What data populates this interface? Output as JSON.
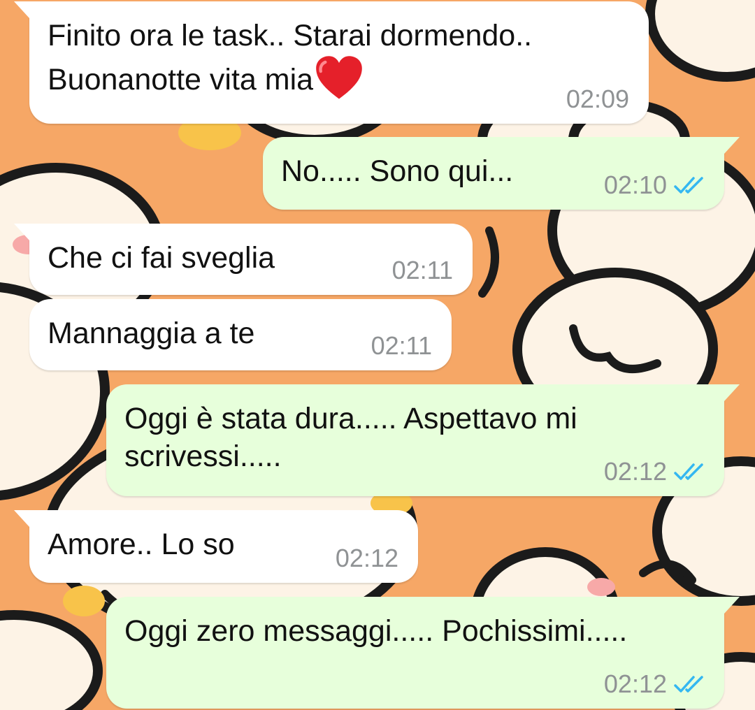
{
  "chat": {
    "colors": {
      "wallpaper": "#f6a766",
      "incoming_bubble": "#ffffff",
      "outgoing_bubble": "#e7ffdb",
      "timestamp": "#8f9294",
      "read_ticks": "#34b7f1"
    },
    "messages": [
      {
        "direction": "incoming",
        "line1": "Finito ora le task.. Starai dormendo..",
        "line2": "Buonanotte vita mia",
        "emoji": "red-heart-icon",
        "time": "02:09"
      },
      {
        "direction": "outgoing",
        "text": "No..... Sono qui...",
        "time": "02:10",
        "status": "read"
      },
      {
        "direction": "incoming",
        "text": "Che ci fai sveglia",
        "time": "02:11"
      },
      {
        "direction": "incoming",
        "text": "Mannaggia a te",
        "time": "02:11"
      },
      {
        "direction": "outgoing",
        "line1": "Oggi è stata dura..... Aspettavo mi",
        "line2": "scrivessi.....",
        "time": "02:12",
        "status": "read"
      },
      {
        "direction": "incoming",
        "text": "Amore.. Lo so",
        "time": "02:12"
      },
      {
        "direction": "outgoing",
        "text": "Oggi zero messaggi..... Pochissimi.....",
        "time": "02:12",
        "status": "read"
      }
    ]
  }
}
